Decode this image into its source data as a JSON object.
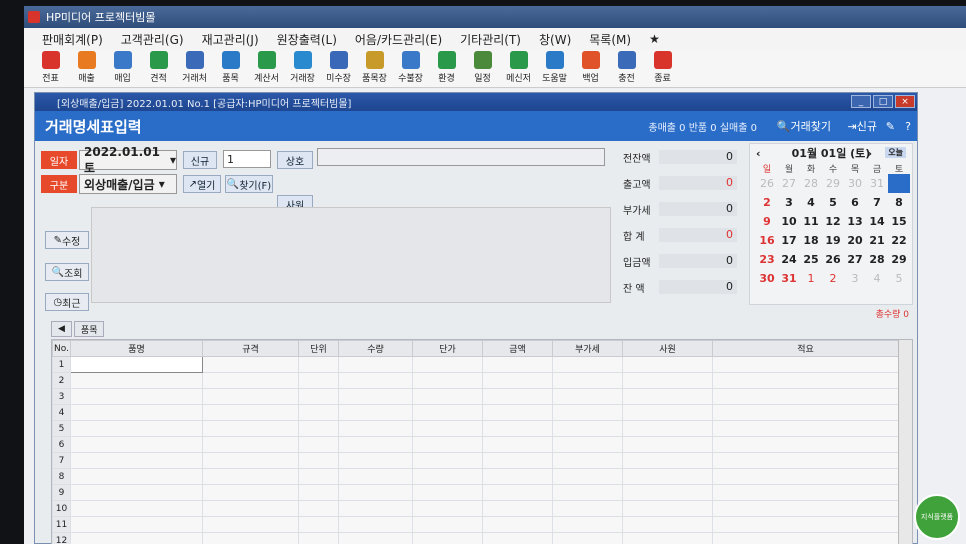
{
  "app_title": "HP미디어 프로젝터빔몰",
  "menu": [
    "판매회계(P)",
    "고객관리(G)",
    "재고관리(J)",
    "원장출력(L)",
    "어음/카드관리(E)",
    "기타관리(T)",
    "창(W)",
    "목록(M)",
    "★"
  ],
  "toolbar": [
    {
      "label": "전표",
      "icon": "slip-icon",
      "color": "#d9342b"
    },
    {
      "label": "매출",
      "icon": "box-icon",
      "color": "#e87a22"
    },
    {
      "label": "매입",
      "icon": "cube-icon",
      "color": "#3a78c8"
    },
    {
      "label": "견적",
      "icon": "estimate-icon",
      "color": "#2a9a4a"
    },
    {
      "label": "거래처",
      "icon": "person-icon",
      "color": "#3a6ab8"
    },
    {
      "label": "품목",
      "icon": "list-icon",
      "color": "#2a7ac8"
    },
    {
      "label": "계산서",
      "icon": "won-icon",
      "color": "#2a9a4a"
    },
    {
      "label": "거래장",
      "icon": "refresh-icon",
      "color": "#2a8ad0"
    },
    {
      "label": "미수장",
      "icon": "document-icon",
      "color": "#3a68b8"
    },
    {
      "label": "품목장",
      "icon": "stack-icon",
      "color": "#c89a2a"
    },
    {
      "label": "수불장",
      "icon": "ledger-icon",
      "color": "#3a78c8"
    },
    {
      "label": "환경",
      "icon": "gear-icon",
      "color": "#2a9a4a"
    },
    {
      "label": "일정",
      "icon": "calendar-icon",
      "color": "#4a8a3a"
    },
    {
      "label": "메신저",
      "icon": "chat-icon",
      "color": "#2a9a4a"
    },
    {
      "label": "도움말",
      "icon": "info-icon",
      "color": "#2a7ac8"
    },
    {
      "label": "백업",
      "icon": "cloud-upload-icon",
      "color": "#e0522a"
    },
    {
      "label": "충전",
      "icon": "lightning-icon",
      "color": "#3a6ab8"
    },
    {
      "label": "종료",
      "icon": "close-icon",
      "color": "#d9342b"
    }
  ],
  "inner_title": "[외상매출/입금] 2022.01.01 No.1 [공급자:HP미디어 프로젝터빔몰]",
  "header": {
    "title": "거래명세표입력",
    "stats": "총매출 0  반품 0  실매출 0",
    "find_label": "거래찾기",
    "new_label": "신규"
  },
  "form": {
    "date_label": "일자",
    "date_value": "2022.01.01 토",
    "new_btn": "신규",
    "seq_value": "1",
    "company_label": "상호",
    "type_label": "구분",
    "type_value": "외상매출/입금",
    "open_btn": "열기",
    "find_btn": "찾기(F)",
    "staff_label": "사원",
    "edit_btn": "수정",
    "search_btn": "조회",
    "recent_btn": "최근"
  },
  "totals": [
    {
      "label": "전잔액",
      "value": "0"
    },
    {
      "label": "출고액",
      "value": "0"
    },
    {
      "label": "부가세",
      "value": "0"
    },
    {
      "label": "합  계",
      "value": "0"
    },
    {
      "label": "입금액",
      "value": "0"
    },
    {
      "label": "잔  액",
      "value": "0"
    }
  ],
  "calendar": {
    "month_label": "01월 01일 (토)",
    "today_btn": "오늘",
    "weekdays": [
      "일",
      "월",
      "화",
      "수",
      "목",
      "금",
      "토"
    ],
    "weeks": [
      [
        "26",
        "27",
        "28",
        "29",
        "30",
        "31",
        "1"
      ],
      [
        "2",
        "3",
        "4",
        "5",
        "6",
        "7",
        "8"
      ],
      [
        "9",
        "10",
        "11",
        "12",
        "13",
        "14",
        "15"
      ],
      [
        "16",
        "17",
        "18",
        "19",
        "20",
        "21",
        "22"
      ],
      [
        "23",
        "24",
        "25",
        "26",
        "27",
        "28",
        "29"
      ],
      [
        "30",
        "31",
        "1",
        "2",
        "3",
        "4",
        "5"
      ]
    ]
  },
  "sum_qty": "총수량 0",
  "tabs": [
    "◀",
    "품목"
  ],
  "columns": [
    "No.",
    "품명",
    "규격",
    "단위",
    "수량",
    "단가",
    "금액",
    "부가세",
    "사원",
    "적요"
  ],
  "row_numbers": [
    "1",
    "2",
    "3",
    "4",
    "5",
    "6",
    "7",
    "8",
    "9",
    "10",
    "11",
    "12"
  ],
  "badge_text": "지식플랫폼"
}
